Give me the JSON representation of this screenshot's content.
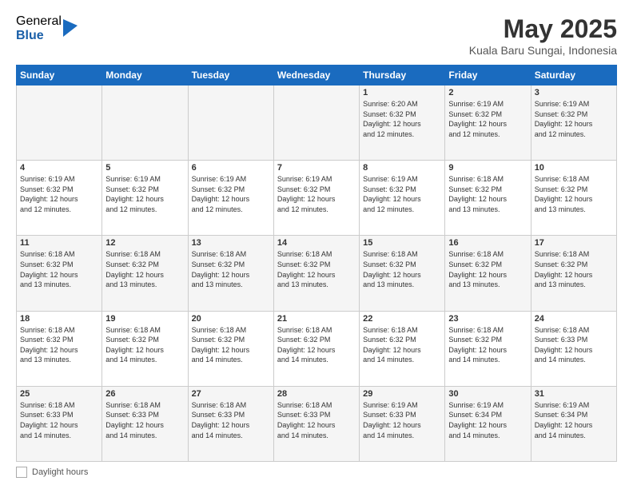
{
  "logo": {
    "general": "General",
    "blue": "Blue"
  },
  "header": {
    "month_year": "May 2025",
    "location": "Kuala Baru Sungai, Indonesia"
  },
  "days_of_week": [
    "Sunday",
    "Monday",
    "Tuesday",
    "Wednesday",
    "Thursday",
    "Friday",
    "Saturday"
  ],
  "weeks": [
    [
      {
        "day": "",
        "info": ""
      },
      {
        "day": "",
        "info": ""
      },
      {
        "day": "",
        "info": ""
      },
      {
        "day": "",
        "info": ""
      },
      {
        "day": "1",
        "info": "Sunrise: 6:20 AM\nSunset: 6:32 PM\nDaylight: 12 hours\nand 12 minutes."
      },
      {
        "day": "2",
        "info": "Sunrise: 6:19 AM\nSunset: 6:32 PM\nDaylight: 12 hours\nand 12 minutes."
      },
      {
        "day": "3",
        "info": "Sunrise: 6:19 AM\nSunset: 6:32 PM\nDaylight: 12 hours\nand 12 minutes."
      }
    ],
    [
      {
        "day": "4",
        "info": "Sunrise: 6:19 AM\nSunset: 6:32 PM\nDaylight: 12 hours\nand 12 minutes."
      },
      {
        "day": "5",
        "info": "Sunrise: 6:19 AM\nSunset: 6:32 PM\nDaylight: 12 hours\nand 12 minutes."
      },
      {
        "day": "6",
        "info": "Sunrise: 6:19 AM\nSunset: 6:32 PM\nDaylight: 12 hours\nand 12 minutes."
      },
      {
        "day": "7",
        "info": "Sunrise: 6:19 AM\nSunset: 6:32 PM\nDaylight: 12 hours\nand 12 minutes."
      },
      {
        "day": "8",
        "info": "Sunrise: 6:19 AM\nSunset: 6:32 PM\nDaylight: 12 hours\nand 12 minutes."
      },
      {
        "day": "9",
        "info": "Sunrise: 6:18 AM\nSunset: 6:32 PM\nDaylight: 12 hours\nand 13 minutes."
      },
      {
        "day": "10",
        "info": "Sunrise: 6:18 AM\nSunset: 6:32 PM\nDaylight: 12 hours\nand 13 minutes."
      }
    ],
    [
      {
        "day": "11",
        "info": "Sunrise: 6:18 AM\nSunset: 6:32 PM\nDaylight: 12 hours\nand 13 minutes."
      },
      {
        "day": "12",
        "info": "Sunrise: 6:18 AM\nSunset: 6:32 PM\nDaylight: 12 hours\nand 13 minutes."
      },
      {
        "day": "13",
        "info": "Sunrise: 6:18 AM\nSunset: 6:32 PM\nDaylight: 12 hours\nand 13 minutes."
      },
      {
        "day": "14",
        "info": "Sunrise: 6:18 AM\nSunset: 6:32 PM\nDaylight: 12 hours\nand 13 minutes."
      },
      {
        "day": "15",
        "info": "Sunrise: 6:18 AM\nSunset: 6:32 PM\nDaylight: 12 hours\nand 13 minutes."
      },
      {
        "day": "16",
        "info": "Sunrise: 6:18 AM\nSunset: 6:32 PM\nDaylight: 12 hours\nand 13 minutes."
      },
      {
        "day": "17",
        "info": "Sunrise: 6:18 AM\nSunset: 6:32 PM\nDaylight: 12 hours\nand 13 minutes."
      }
    ],
    [
      {
        "day": "18",
        "info": "Sunrise: 6:18 AM\nSunset: 6:32 PM\nDaylight: 12 hours\nand 13 minutes."
      },
      {
        "day": "19",
        "info": "Sunrise: 6:18 AM\nSunset: 6:32 PM\nDaylight: 12 hours\nand 14 minutes."
      },
      {
        "day": "20",
        "info": "Sunrise: 6:18 AM\nSunset: 6:32 PM\nDaylight: 12 hours\nand 14 minutes."
      },
      {
        "day": "21",
        "info": "Sunrise: 6:18 AM\nSunset: 6:32 PM\nDaylight: 12 hours\nand 14 minutes."
      },
      {
        "day": "22",
        "info": "Sunrise: 6:18 AM\nSunset: 6:32 PM\nDaylight: 12 hours\nand 14 minutes."
      },
      {
        "day": "23",
        "info": "Sunrise: 6:18 AM\nSunset: 6:32 PM\nDaylight: 12 hours\nand 14 minutes."
      },
      {
        "day": "24",
        "info": "Sunrise: 6:18 AM\nSunset: 6:33 PM\nDaylight: 12 hours\nand 14 minutes."
      }
    ],
    [
      {
        "day": "25",
        "info": "Sunrise: 6:18 AM\nSunset: 6:33 PM\nDaylight: 12 hours\nand 14 minutes."
      },
      {
        "day": "26",
        "info": "Sunrise: 6:18 AM\nSunset: 6:33 PM\nDaylight: 12 hours\nand 14 minutes."
      },
      {
        "day": "27",
        "info": "Sunrise: 6:18 AM\nSunset: 6:33 PM\nDaylight: 12 hours\nand 14 minutes."
      },
      {
        "day": "28",
        "info": "Sunrise: 6:18 AM\nSunset: 6:33 PM\nDaylight: 12 hours\nand 14 minutes."
      },
      {
        "day": "29",
        "info": "Sunrise: 6:19 AM\nSunset: 6:33 PM\nDaylight: 12 hours\nand 14 minutes."
      },
      {
        "day": "30",
        "info": "Sunrise: 6:19 AM\nSunset: 6:34 PM\nDaylight: 12 hours\nand 14 minutes."
      },
      {
        "day": "31",
        "info": "Sunrise: 6:19 AM\nSunset: 6:34 PM\nDaylight: 12 hours\nand 14 minutes."
      }
    ]
  ],
  "footer": {
    "daylight_label": "Daylight hours"
  }
}
